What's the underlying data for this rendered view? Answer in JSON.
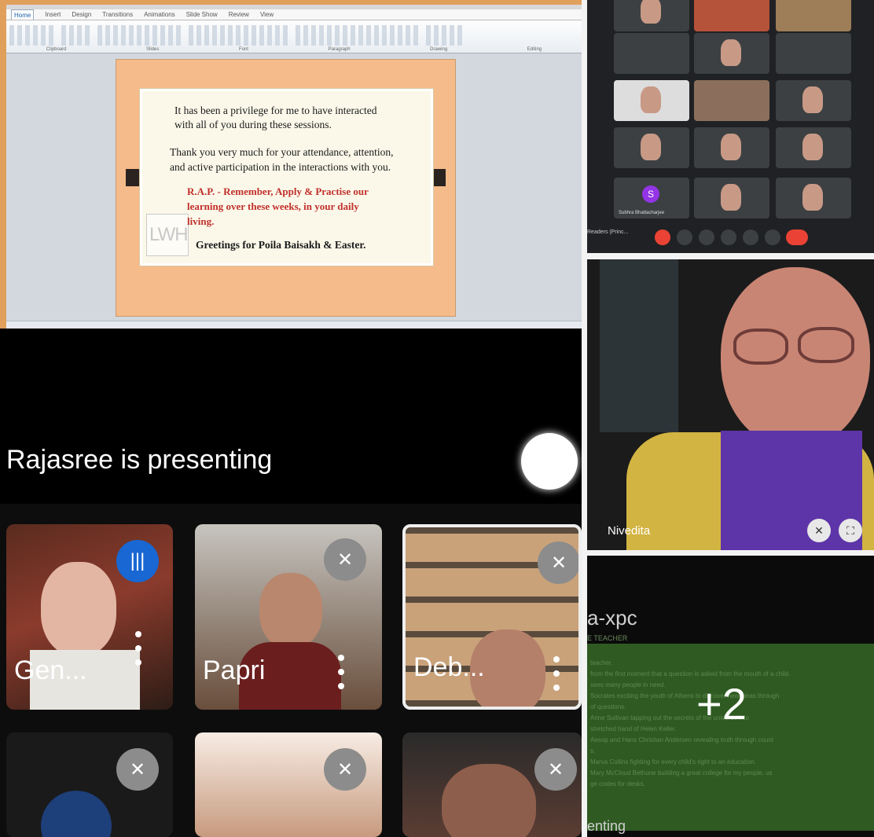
{
  "ppt": {
    "tabs": [
      "Home",
      "Insert",
      "Design",
      "Transitions",
      "Animations",
      "Slide Show",
      "Review",
      "View"
    ],
    "ribbon_groups": [
      "Clipboard",
      "Slides",
      "Font",
      "Paragraph",
      "Drawing",
      "Editing"
    ],
    "slide": {
      "line1": "It has been a privilege for me to have interacted",
      "line2": "with all of you during these sessions.",
      "line3": "Thank you very much for your attendance, attention,",
      "line4": "and active participation in the interactions with you.",
      "line5": "R.A.P. - Remember, Apply & Practise  our",
      "line6": "learning over these weeks, in your daily",
      "line7": "living.",
      "line8": "Greetings for Poila Baisakh & Easter.",
      "logo_text": "LWH"
    }
  },
  "meet": {
    "presenting_text": "Rajasree is presenting",
    "tiles": [
      {
        "name": "Gen...",
        "mic": "speaking"
      },
      {
        "name": "Papri",
        "mic": "muted"
      },
      {
        "name": "Deb...",
        "mic": "muted"
      }
    ],
    "bottom_row_mics": [
      "muted",
      "muted",
      "muted"
    ]
  },
  "grid": {
    "participant_initial": "S",
    "participant_label": "Subhra Bhattacharjee",
    "bottom_left_label": "Readers (Princ..."
  },
  "speaker": {
    "name": "Nivedita"
  },
  "overflow": {
    "count_label": "+2",
    "doc_title": "a-xpc",
    "doc_subtitle": "E TEACHER",
    "doc_lines": [
      "teacher.",
      "from the first moment that a question is asked from the mouth of a child.",
      "sees many people in need.",
      "Socrates exciting the youth of Athens to discover new ideas through",
      "of questions.",
      "Anne Sullivan tapping out the secrets of the universe into",
      "stretched hand of Helen Keller.",
      "Aesop and Hans Christian Andersen revealing truth through count",
      "s.",
      "Marva Collins fighting for every child's right to an education.",
      "Mary McCloud Bethune building a great college for my people, us",
      "ge crates for desks."
    ],
    "footer": "enting"
  },
  "colors": {
    "frame_accent": "#e0a05c",
    "slide_bg": "#f6bb8a",
    "slide_red": "#c2302b",
    "meet_blue": "#1967d2",
    "leave_red": "#ea4335"
  }
}
